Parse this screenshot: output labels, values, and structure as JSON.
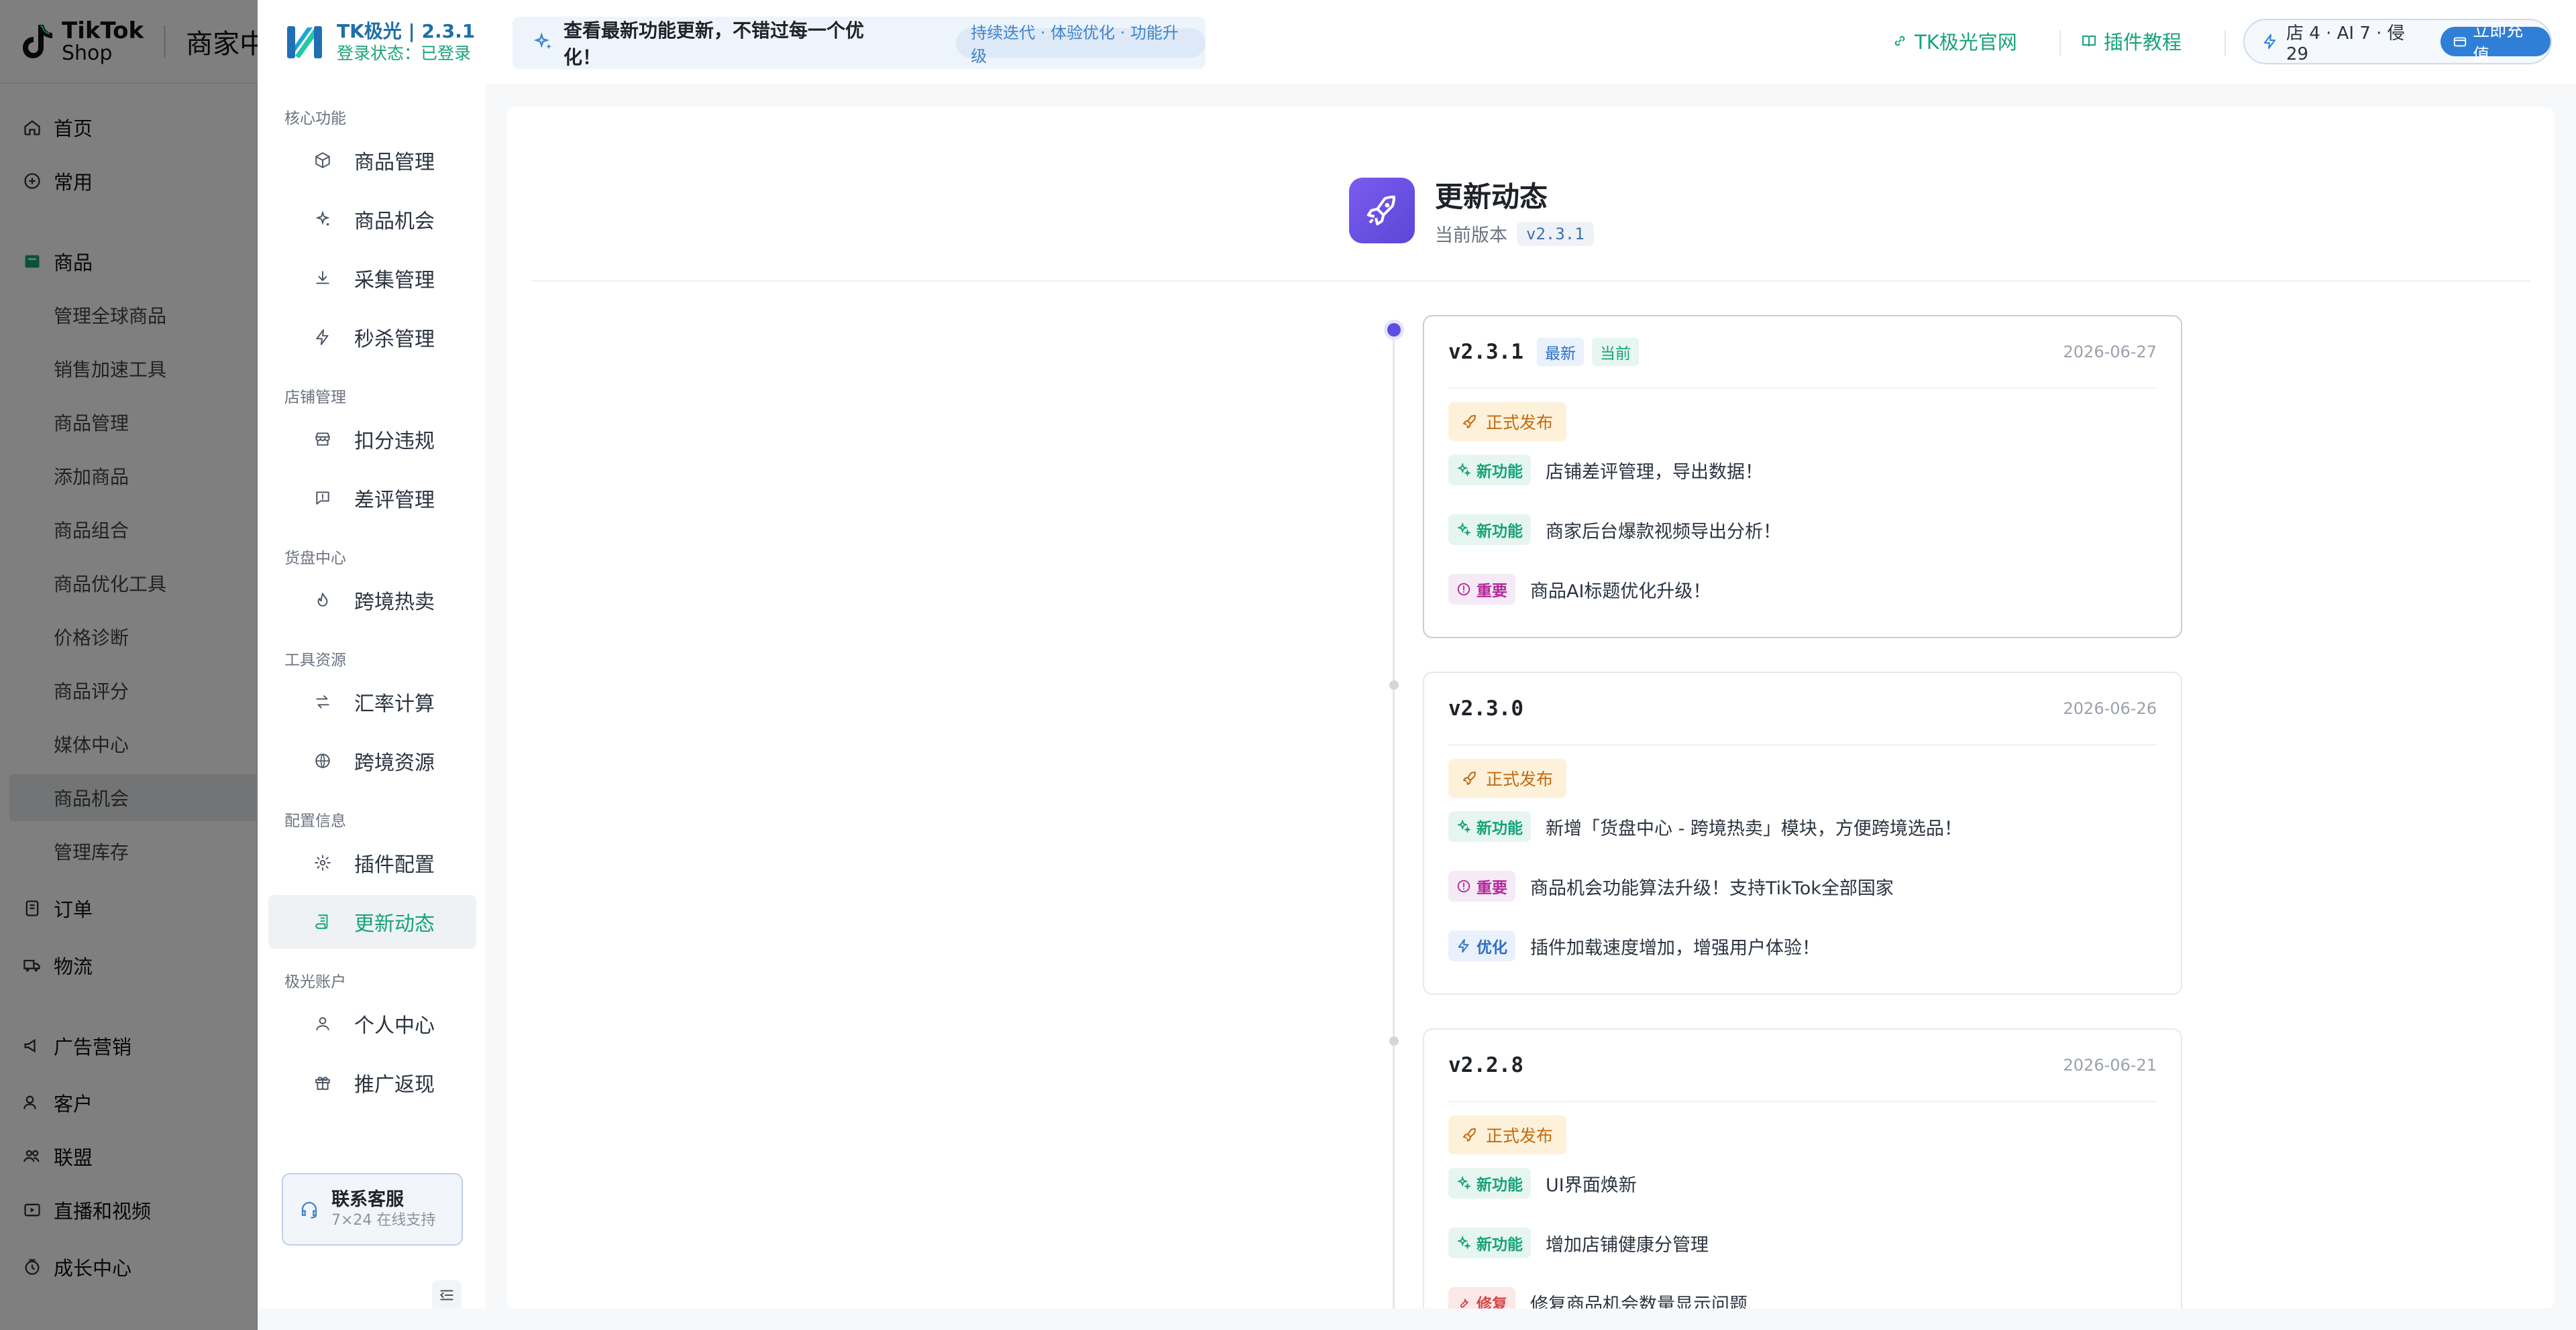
{
  "background": {
    "header": {
      "logo_line1": "TikTok",
      "logo_line2": "Shop",
      "center_title": "商家中心"
    },
    "sidebar": {
      "items": [
        {
          "label": "首页",
          "icon": "home-icon"
        },
        {
          "label": "常用",
          "icon": "plus-circle-icon"
        },
        {
          "label": "商品",
          "icon": "product-icon"
        },
        {
          "label": "管理全球商品"
        },
        {
          "label": "销售加速工具"
        },
        {
          "label": "商品管理"
        },
        {
          "label": "添加商品"
        },
        {
          "label": "商品组合"
        },
        {
          "label": "商品优化工具"
        },
        {
          "label": "价格诊断"
        },
        {
          "label": "商品评分"
        },
        {
          "label": "媒体中心"
        },
        {
          "label": "商品机会"
        },
        {
          "label": "管理库存"
        },
        {
          "label": "订单",
          "icon": "order-icon"
        },
        {
          "label": "物流",
          "icon": "truck-icon"
        },
        {
          "label": "广告营销",
          "icon": "megaphone-icon"
        },
        {
          "label": "客户",
          "icon": "users-icon"
        },
        {
          "label": "联盟",
          "icon": "people-icon"
        },
        {
          "label": "直播和视频",
          "icon": "video-icon"
        },
        {
          "label": "成长中心",
          "icon": "growth-icon"
        }
      ]
    }
  },
  "extension": {
    "brand": {
      "title": "TK极光 | 2.3.1",
      "status": "登录状态：已登录"
    },
    "notice": {
      "text": "查看最新功能更新，不错过每一个优化！",
      "chip": "持续迭代 · 体验优化 · 功能升级"
    },
    "links": {
      "official": "TK极光官网",
      "tutorial": "插件教程"
    },
    "quota": {
      "text": "店 4 · AI 7 · 侵 29",
      "recharge": "立即充值"
    },
    "nav": {
      "sections": [
        {
          "title": "核心功能",
          "items": [
            {
              "label": "商品管理",
              "icon": "cube-icon"
            },
            {
              "label": "商品机会",
              "icon": "sparkle-icon"
            },
            {
              "label": "采集管理",
              "icon": "download-icon"
            },
            {
              "label": "秒杀管理",
              "icon": "bolt-icon"
            }
          ]
        },
        {
          "title": "店铺管理",
          "items": [
            {
              "label": "扣分违规",
              "icon": "store-icon"
            },
            {
              "label": "差评管理",
              "icon": "message-alert-icon"
            }
          ]
        },
        {
          "title": "货盘中心",
          "items": [
            {
              "label": "跨境热卖",
              "icon": "flame-icon"
            }
          ]
        },
        {
          "title": "工具资源",
          "items": [
            {
              "label": "汇率计算",
              "icon": "exchange-icon"
            },
            {
              "label": "跨境资源",
              "icon": "globe-icon"
            }
          ]
        },
        {
          "title": "配置信息",
          "items": [
            {
              "label": "插件配置",
              "icon": "gear-icon"
            },
            {
              "label": "更新动态",
              "icon": "scroll-icon"
            }
          ]
        },
        {
          "title": "极光账户",
          "items": [
            {
              "label": "个人中心",
              "icon": "user-icon"
            },
            {
              "label": "推广返现",
              "icon": "gift-icon"
            }
          ]
        }
      ],
      "active": "更新动态",
      "contact": {
        "title": "联系客服",
        "subtitle": "7×24 在线支持"
      }
    },
    "page": {
      "title": "更新动态",
      "current_label": "当前版本",
      "current_version": "v2.3.1",
      "releases": [
        {
          "version": "v2.3.1",
          "tag_new": "最新",
          "tag_current": "当前",
          "date": "2026-06-27",
          "badge": "正式发布",
          "entries": [
            {
              "type": "feature",
              "tag": "新功能",
              "text": "店铺差评管理，导出数据！"
            },
            {
              "type": "feature",
              "tag": "新功能",
              "text": "商家后台爆款视频导出分析！"
            },
            {
              "type": "important",
              "tag": "重要",
              "text": "商品AI标题优化升级！"
            }
          ]
        },
        {
          "version": "v2.3.0",
          "date": "2026-06-26",
          "badge": "正式发布",
          "entries": [
            {
              "type": "feature",
              "tag": "新功能",
              "text": "新增「货盘中心 - 跨境热卖」模块，方便跨境选品！"
            },
            {
              "type": "important",
              "tag": "重要",
              "text": "商品机会功能算法升级！支持TikTok全部国家"
            },
            {
              "type": "optimize",
              "tag": "优化",
              "text": "插件加载速度增加，增强用户体验！"
            }
          ]
        },
        {
          "version": "v2.2.8",
          "date": "2026-06-21",
          "badge": "正式发布",
          "entries": [
            {
              "type": "feature",
              "tag": "新功能",
              "text": "UI界面焕新"
            },
            {
              "type": "feature",
              "tag": "新功能",
              "text": "增加店铺健康分管理"
            },
            {
              "type": "fix",
              "tag": "修复",
              "text": "修复商品机会数量显示问题"
            }
          ]
        }
      ]
    }
  },
  "colors": {
    "accent": "#16a37a",
    "brand_blue": "#1e6fa8",
    "rocket": "#6a4fe3",
    "overlay": "rgba(0,0,0,0.5)"
  }
}
